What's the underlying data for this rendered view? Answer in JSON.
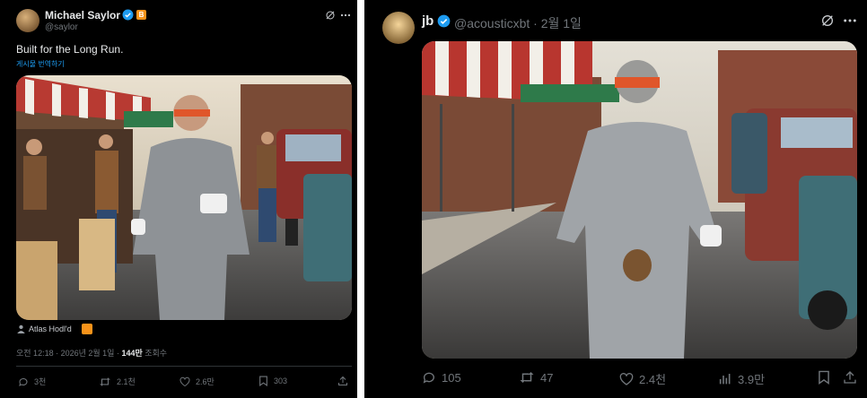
{
  "left_post": {
    "author_name": "Michael Saylor",
    "handle": "@saylor",
    "text": "Built for the Long Run.",
    "translate_link": "게시물 번역하기",
    "media_credit": "Atlas Hodl'd",
    "timestamp": "오전 12:18 · 2026년 2월 1일 · ",
    "views_count": "144만",
    "views_label": " 조회수",
    "actions": {
      "replies": "3천",
      "reposts": "2.1천",
      "likes": "2.6만",
      "bookmarks": "303"
    },
    "badge_letter": "B"
  },
  "right_post": {
    "author_name": "jb",
    "handle": "@acousticxbt",
    "date": "· 2월 1일",
    "actions": {
      "replies": "105",
      "reposts": "47",
      "likes": "2.4천",
      "views": "3.9만"
    }
  },
  "colors": {
    "background": "#000000",
    "text": "#e7e9ea",
    "muted": "#71767b",
    "link": "#1d9bf0",
    "verified": "#1d9bf0",
    "badge": "#f7931a"
  }
}
